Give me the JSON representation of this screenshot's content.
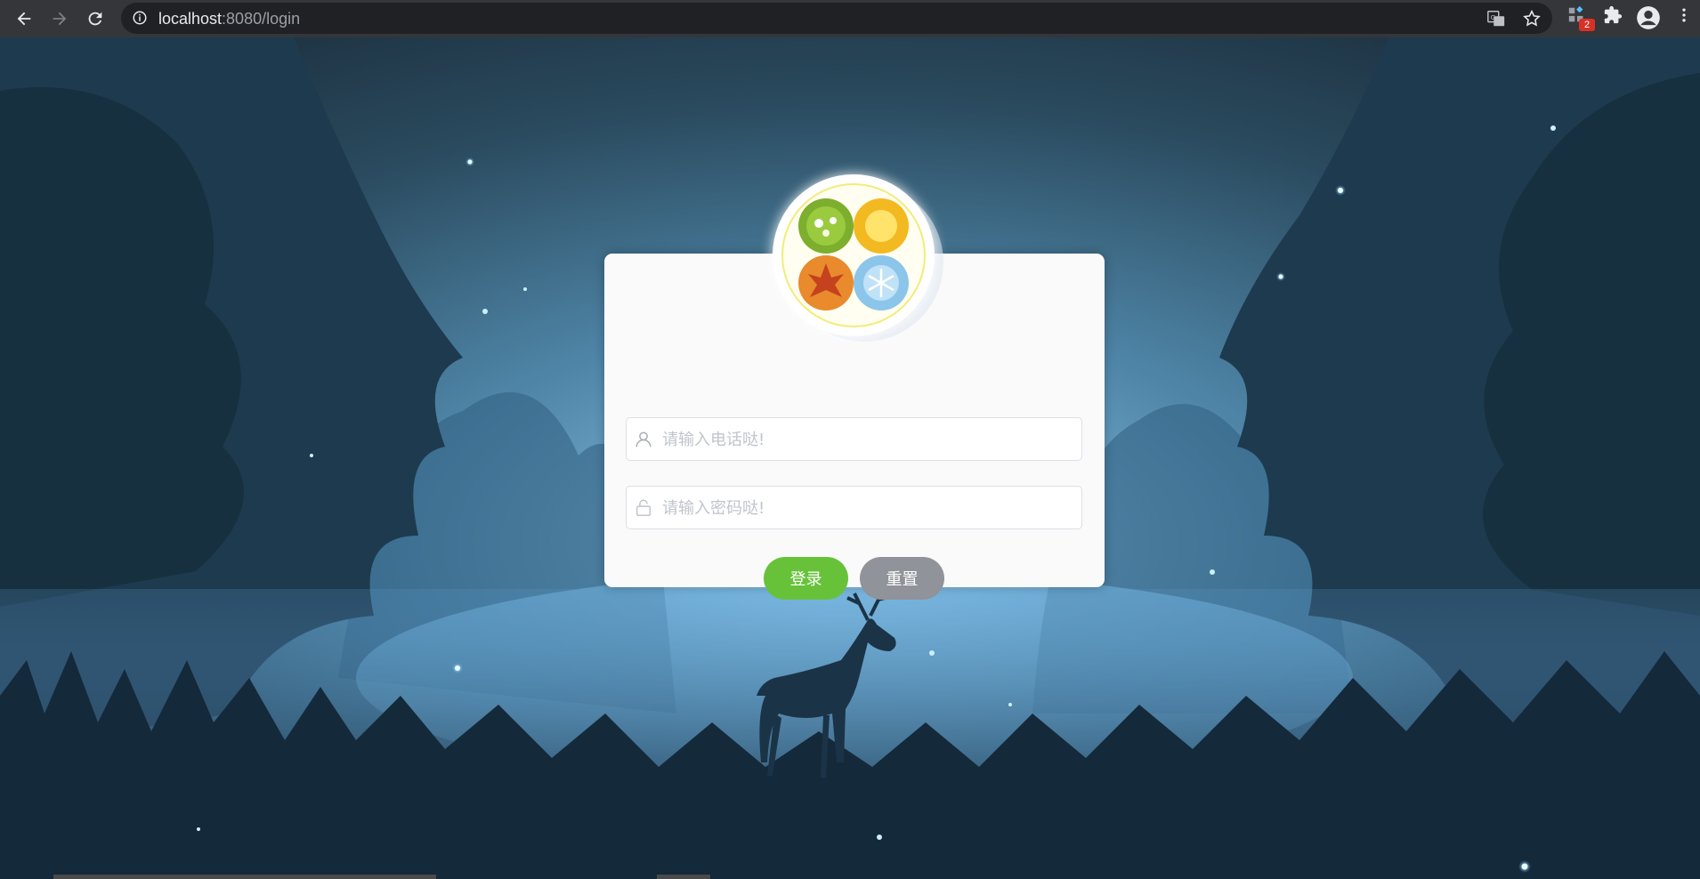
{
  "browser": {
    "url_host": "localhost",
    "url_path": ":8080/login",
    "icons": [
      "back-arrow-icon",
      "forward-arrow-icon",
      "reload-icon",
      "info-icon",
      "translate-icon",
      "bookmark-star-icon",
      "extension-puzzle-icon",
      "profile-avatar-icon",
      "menu-kebab-icon"
    ],
    "extension_badge": "2"
  },
  "login_form": {
    "phone_placeholder": "请输入电话哒!",
    "password_placeholder": "请输入密码哒!",
    "login_label": "登录",
    "reset_label": "重置",
    "icons": [
      "user-icon",
      "lock-icon",
      "four-seasons-logo"
    ]
  },
  "colors": {
    "login_button": "#67c23a",
    "reset_button": "#909399",
    "chrome_toolbar": "#35363a",
    "card_background": "#fafafa"
  }
}
